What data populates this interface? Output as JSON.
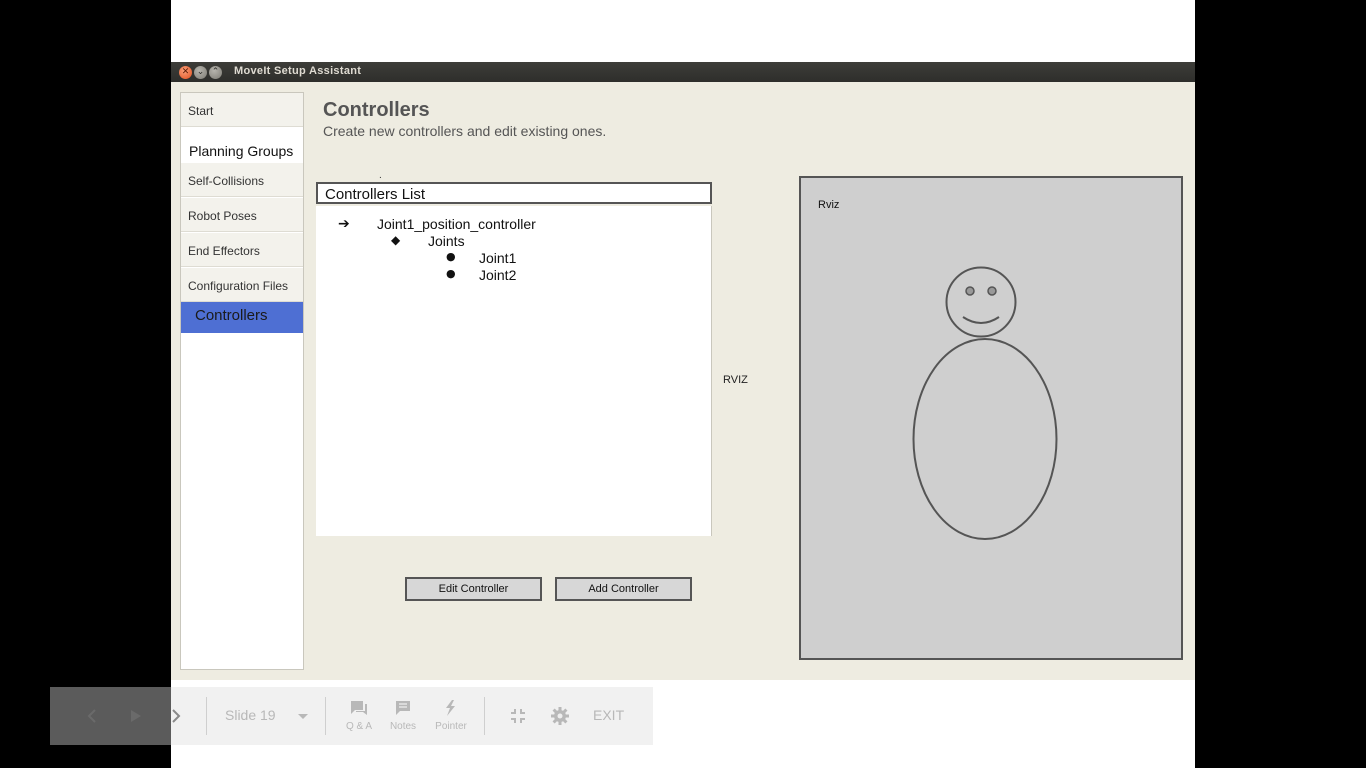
{
  "window": {
    "title": "MoveIt Setup Assistant"
  },
  "sidebar": {
    "items": [
      {
        "label": "Start"
      },
      {
        "label": "Planning Groups"
      },
      {
        "label": "Self-Collisions"
      },
      {
        "label": "Robot Poses"
      },
      {
        "label": "End Effectors"
      },
      {
        "label": "Configuration Files"
      },
      {
        "label": "Controllers"
      }
    ]
  },
  "main": {
    "title": "Controllers",
    "subtitle": "Create new controllers and edit existing ones.",
    "dot": ".",
    "list_header": "Controllers List",
    "tree": {
      "controller": "Joint1_position_controller",
      "group": "Joints",
      "joints": [
        "Joint1",
        "Joint2"
      ]
    },
    "rviz_side_label": "RVIZ",
    "buttons": {
      "edit": "Edit Controller",
      "add": "Add Controller"
    }
  },
  "rviz": {
    "title": "Rviz"
  },
  "presenter_toolbar": {
    "slide_label": "Slide 19",
    "qa_label": "Q & A",
    "notes_label": "Notes",
    "pointer_label": "Pointer",
    "exit_label": "EXIT"
  }
}
